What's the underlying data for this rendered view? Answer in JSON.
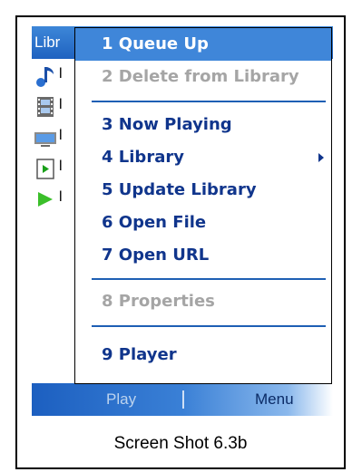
{
  "screen": {
    "title": "Libr",
    "bg_rows": [
      {
        "icon": "music-note-icon",
        "label": "l"
      },
      {
        "icon": "video-film-icon",
        "label": "l"
      },
      {
        "icon": "tv-icon",
        "label": "l"
      },
      {
        "icon": "playlist-file-icon",
        "label": "l"
      },
      {
        "icon": "play-arrow-icon",
        "label": "l"
      }
    ]
  },
  "menu": {
    "items": [
      {
        "label": "1 Queue Up",
        "state": "highlighted"
      },
      {
        "label": "2 Delete from Library",
        "state": "disabled"
      },
      {
        "label": "3 Now Playing",
        "state": "enabled"
      },
      {
        "label": "4 Library",
        "state": "enabled",
        "submenu": true
      },
      {
        "label": "5 Update Library",
        "state": "enabled"
      },
      {
        "label": "6 Open File",
        "state": "enabled"
      },
      {
        "label": "7 Open URL",
        "state": "enabled"
      },
      {
        "label": "8 Properties",
        "state": "disabled"
      },
      {
        "label": "9 Player",
        "state": "enabled"
      }
    ]
  },
  "softkeys": {
    "left": "Play",
    "right": "Menu"
  },
  "caption": "Screen Shot 6.3b",
  "colors": {
    "highlight": "#3f86d9",
    "menu_text": "#10358c",
    "disabled_text": "#a5a5a5",
    "separator": "#1e5fb4"
  }
}
